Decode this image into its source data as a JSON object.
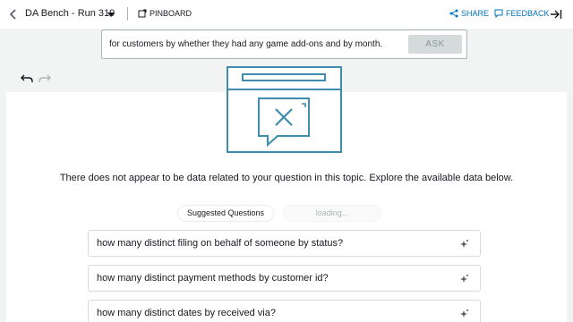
{
  "header": {
    "title": "DA Bench - Run 319",
    "pinboard_label": "PINBOARD",
    "share_label": "SHARE",
    "feedback_label": "FEEDBACK"
  },
  "query": {
    "text": "for customers by whether they had any game add-ons and by month.",
    "ask_label": "ASK"
  },
  "message": "There does not appear to be data related to your question in this topic. Explore the available data below.",
  "suggestions": {
    "label": "Suggested Questions",
    "loading": "loading...",
    "items": [
      {
        "label": "how many distinct filing on behalf of someone by status?"
      },
      {
        "label": "how many distinct payment methods by customer id?"
      },
      {
        "label": "how many distinct dates by received via?"
      }
    ]
  },
  "colors": {
    "accent": "#0073bb",
    "illustration": "#3f8dac"
  }
}
